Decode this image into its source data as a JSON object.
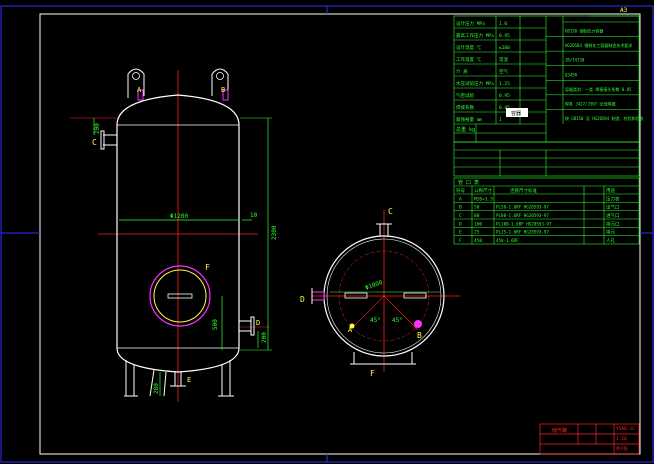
{
  "sheet": {
    "corner_code": "A3",
    "view_label_top": "1"
  },
  "elevation": {
    "nozzle_labels": [
      "A",
      "B",
      "C",
      "D",
      "E",
      "F"
    ],
    "dim_diameter": "Φ1200",
    "dim_height": "2300",
    "dim_10": "10",
    "dim_200_left": "200",
    "dim_500": "500",
    "dim_200_right": "200",
    "dim_280": "280"
  },
  "plan": {
    "nozzle_labels": [
      "A",
      "B",
      "C",
      "D",
      "E",
      "F"
    ],
    "dim_radius": "Φ1000",
    "angle_a": "45°",
    "angle_b": "45°"
  },
  "spec_table": {
    "rows": [
      {
        "k": "设计压力 MPa",
        "v": "1.0"
      },
      {
        "k": "最高工作压力 MPa",
        "v": "0.95"
      },
      {
        "k": "设计温度 ℃",
        "v": "≤100"
      },
      {
        "k": "工作温度 ℃",
        "v": "常温"
      },
      {
        "k": "介 质",
        "v": "空气"
      },
      {
        "k": "水压试验压力 MPa",
        "v": "1.25"
      },
      {
        "k": "气密试验",
        "v": "0.95"
      },
      {
        "k": "焊缝系数",
        "v": "0.85"
      },
      {
        "k": "腐蚀裕量 mm",
        "v": "1"
      }
    ],
    "right_rows": [
      "GB150 钢制压力容器",
      "HG20584 钢制化工容器制造技术要求",
      "JB/T4730",
      "Q345R",
      "容器类别：一类 焊接接头系数 0.85",
      "焊条 J427/J507 全部焊缝",
      "按 GB150 及 HG20584 制造、检验和验收"
    ],
    "stamp": "容器",
    "weight_label": "总重 kg",
    "section2_title": "管 口 表"
  },
  "nozzle_table": {
    "title": "管 口 表",
    "headers": [
      "符号",
      "公称尺寸",
      "连接尺寸标准",
      "用途"
    ],
    "rows": [
      {
        "sym": "A",
        "size": "M20×1.5",
        "std": "",
        "use": "压力表"
      },
      {
        "sym": "B",
        "size": "50",
        "std": "PL50-1.6RF HG20593-97",
        "use": "出气口"
      },
      {
        "sym": "C",
        "size": "80",
        "std": "PL80-1.6RF HG20593-97",
        "use": "进气口"
      },
      {
        "sym": "D",
        "size": "100",
        "std": "PL100-1.6RF HG20593-97",
        "use": "排污口"
      },
      {
        "sym": "E",
        "size": "25",
        "std": "PL25-1.6RF HG20593-97",
        "use": "排污"
      },
      {
        "sym": "F",
        "size": "450",
        "std": "450-1.6RF",
        "use": "人孔"
      }
    ]
  },
  "title_block": {
    "drawing_no": "YSAB-1C",
    "name": "储气罐",
    "scale": "1:20",
    "sheet": "共1张"
  },
  "colors": {
    "frame": "#ffffff",
    "border": "#3030ff",
    "geometry": "#ffffff",
    "centerline": "#ff2020",
    "dimension": "#30ff30",
    "manway": "#ff30ff",
    "label": "#ffff40",
    "table": "#30ff30",
    "nozzle": "#ff30ff"
  }
}
